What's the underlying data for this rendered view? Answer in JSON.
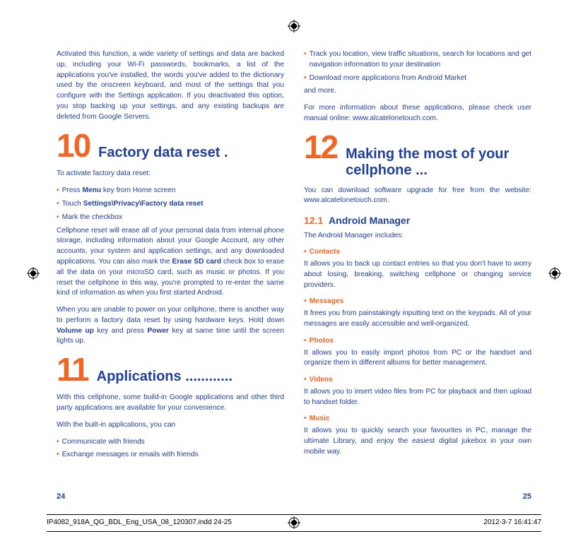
{
  "leftCol": {
    "intro": "Activated this function, a wide variety of settings and data are backed up, including your Wi-Fi passwords, bookmarks, a list of the applications you've installed, the words you've added to the dictionary used by the onscreen keyboard, and most of the settings that you configure with the Settings application. If you deactivated this option, you stop backing up your settings, and any existing backups are deleted from Google Servers.",
    "s10num": "10",
    "s10title": "Factory data reset .",
    "s10lead": "To activate factory data reset:",
    "s10b1a": "Press ",
    "s10b1b": "Menu",
    "s10b1c": " key from Home screen",
    "s10b2a": "Touch ",
    "s10b2b": "Settings\\Privacy\\Factory data reset",
    "s10b3": "Mark the checkbox",
    "s10p1a": "Cellphone reset will erase all of your personal data from internal phone storage, including information about your Google Account, any other accounts, your system and application settings, and any downloaded applications. You can also mark the ",
    "s10p1b": "Erase SD card",
    "s10p1c": " check box to erase all the data on your microSD card, such as music or photos. If you reset the cellphone in this way, you're prompted to re-enter the same kind of information as when you first started Android.",
    "s10p2a": "When you are unable to power on your cellphone, there is another way to perform a factory data reset by using hardware keys. Hold down ",
    "s10p2b": "Volume up",
    "s10p2c": " key and press ",
    "s10p2d": "Power",
    "s10p2e": " key at same time until the screen lights up.",
    "s11num": "11",
    "s11title": "Applications ............",
    "s11p1": "With this cellphone, some build-in Google applications and other third party applications are available for your convenience.",
    "s11p2": "With the built-in applications, you can",
    "s11b1": "Communicate with friends",
    "s11b2": "Exchange messages or emails with friends"
  },
  "rightCol": {
    "rb1": "Track you location, view traffic situations, search for locations and get navigation information to your destination",
    "rb2": "Download more applications from Android Market",
    "rp1": "and more.",
    "rp2": "For more information about these applications, please check user manual  online: www.alcatelonetouch.com.",
    "s12num": "12",
    "s12title": "Making the most of your cellphone ...",
    "s12p1": "You can download software upgrade for free from the website: www.alcatelonetouch.com.",
    "subnum": "12.1",
    "subtitle": "Android Manager",
    "amlead": "The Android Manager includes:",
    "f1": "Contacts",
    "f1d": "It allows you to back up contact entries so that you don't have to worry about losing, breaking, switching cellphone or changing service providers.",
    "f2": "Messages",
    "f2d": "It frees you from painstakingly inputting text on the keypads. All of your messages are easily accessible and well-organized.",
    "f3": "Photos",
    "f3d": "It allows you to easily import photos from PC or the handset and organize them in different albums for better management.",
    "f4": "Videos",
    "f4d": "It allows you to insert video files from PC for playback and then upload to handset folder.",
    "f5": "Music",
    "f5d": "It allows you to quickly search your favourites in PC, manage the ultimate Library, and enjoy the easiest digital jukebox in your own mobile way."
  },
  "pageLeft": "24",
  "pageRight": "25",
  "slug": "IP4082_918A_QG_BDL_Eng_USA_08_120307.indd   24-25",
  "timestamp": "2012-3-7   16:41:47"
}
